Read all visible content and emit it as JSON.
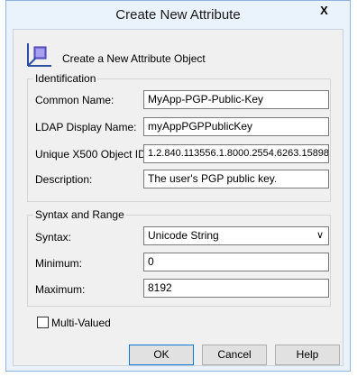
{
  "window": {
    "title": "Create New Attribute",
    "close_label": "X"
  },
  "header": {
    "text": "Create a New Attribute Object",
    "icon": "attribute-icon"
  },
  "identification": {
    "label": "Identification",
    "common_name": {
      "label": "Common Name:",
      "value": "MyApp-PGP-Public-Key"
    },
    "ldap_name": {
      "label": "LDAP Display Name:",
      "value": "myAppPGPPublicKey"
    },
    "oid": {
      "label": "Unique X500 Object ID:",
      "value": "1.2.840.113556.1.8000.2554.6263.15898"
    },
    "description": {
      "label": "Description:",
      "value": "The user's PGP public key."
    }
  },
  "syntax_range": {
    "label": "Syntax and Range",
    "syntax": {
      "label": "Syntax:",
      "value": "Unicode String"
    },
    "minimum": {
      "label": "Minimum:",
      "value": "0"
    },
    "maximum": {
      "label": "Maximum:",
      "value": "8192"
    }
  },
  "multivalued": {
    "label": "Multi-Valued",
    "checked": false
  },
  "buttons": {
    "ok": "OK",
    "cancel": "Cancel",
    "help": "Help"
  }
}
